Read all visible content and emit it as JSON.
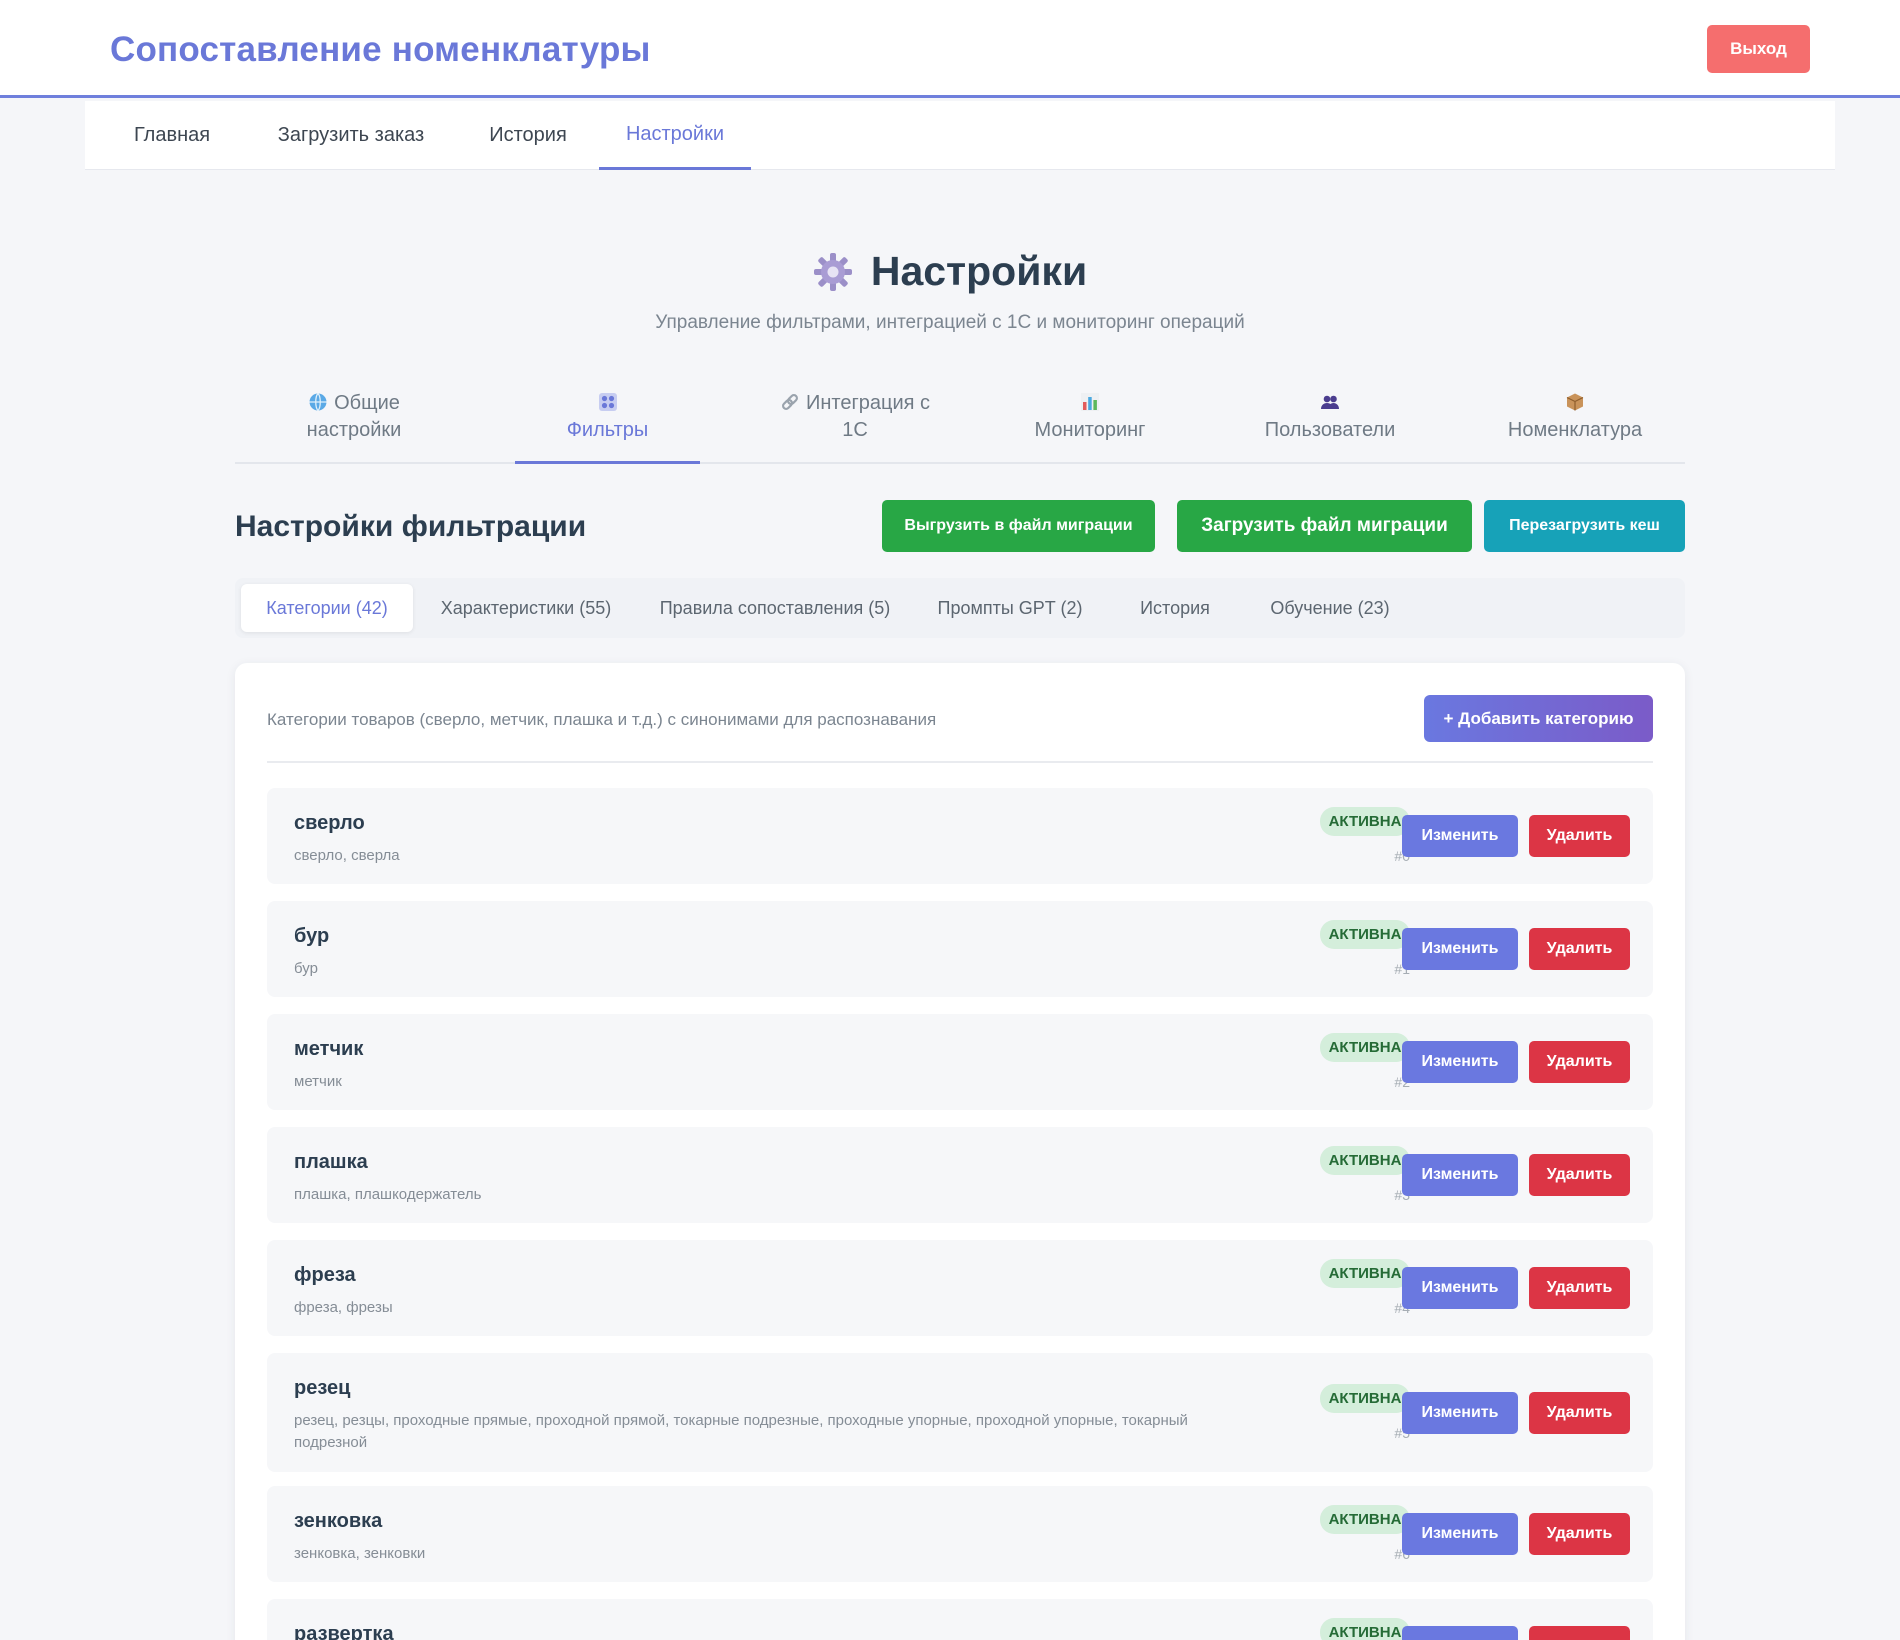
{
  "header": {
    "app_title": "Сопоставление номенклатуры",
    "logout_label": "Выход"
  },
  "main_nav": {
    "items": [
      {
        "label": "Главная"
      },
      {
        "label": "Загрузить заказ"
      },
      {
        "label": "История"
      },
      {
        "label": "Настройки",
        "active": true
      }
    ]
  },
  "page": {
    "title": "Настройки",
    "title_icon": "gear-icon",
    "subtitle": "Управление фильтрами, интеграцией с 1С и мониторинг операций"
  },
  "section_tabs": [
    {
      "icon": "globe-icon",
      "line1": "Общие",
      "line2": "настройки"
    },
    {
      "icon": "grid-icon",
      "line1": "",
      "line2": "Фильтры",
      "active": true
    },
    {
      "icon": "link-icon",
      "line1": "Интеграция с",
      "line2": "1С"
    },
    {
      "icon": "bar-chart-icon",
      "line1": "",
      "line2": "Мониторинг"
    },
    {
      "icon": "users-icon",
      "line1": "",
      "line2": "Пользователи"
    },
    {
      "icon": "package-icon",
      "line1": "",
      "line2": "Номенклатура"
    }
  ],
  "filters": {
    "title": "Настройки фильтрации",
    "export_label": "Выгрузить в файл миграции",
    "import_label": "Загрузить файл миграции",
    "reload_label": "Перезагрузить кеш"
  },
  "sub_tabs": [
    {
      "label": "Категории (42)",
      "active": true
    },
    {
      "label": "Характеристики (55)"
    },
    {
      "label": "Правила сопоставления (5)"
    },
    {
      "label": "Промпты GPT (2)"
    },
    {
      "label": "История"
    },
    {
      "label": "Обучение (23)"
    }
  ],
  "categories": {
    "description": "Категории товаров (сверло, метчик, плашка и т.д.) с синонимами для распознавания",
    "add_label": "+ Добавить категорию",
    "edit_label": "Изменить",
    "delete_label": "Удалить",
    "items": [
      {
        "name": "сверло",
        "synonyms": "сверло, сверла",
        "status": "АКТИВНА",
        "index": "#0"
      },
      {
        "name": "бур",
        "synonyms": "бур",
        "status": "АКТИВНА",
        "index": "#1"
      },
      {
        "name": "метчик",
        "synonyms": "метчик",
        "status": "АКТИВНА",
        "index": "#2"
      },
      {
        "name": "плашка",
        "synonyms": "плашка, плашкодержатель",
        "status": "АКТИВНА",
        "index": "#3"
      },
      {
        "name": "фреза",
        "synonyms": "фреза, фрезы",
        "status": "АКТИВНА",
        "index": "#4"
      },
      {
        "name": "резец",
        "synonyms": "резец, резцы, проходные прямые, проходной прямой, токарные подрезные, проходные упорные, проходной упорные, токарный подрезной",
        "status": "АКТИВНА",
        "index": "#5"
      },
      {
        "name": "зенковка",
        "synonyms": "зенковка, зенковки",
        "status": "АКТИВНА",
        "index": "#6"
      },
      {
        "name": "развертка",
        "synonyms": "",
        "status": "АКТИВНА",
        "index": ""
      }
    ]
  },
  "colors": {
    "accent": "#6a78d8",
    "danger": "#dc3545",
    "success": "#28a745",
    "info": "#17a2b8",
    "logout": "#f56e6e"
  }
}
